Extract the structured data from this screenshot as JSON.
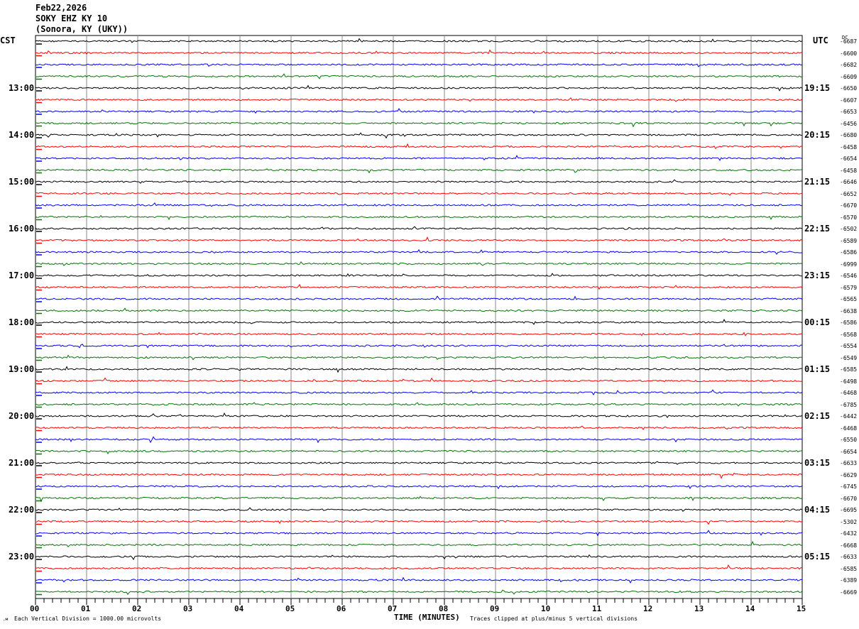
{
  "header": {
    "date": "Feb22,2026",
    "station": "SOKY EHZ KY 10",
    "location": "(Sonora, KY (UKY))"
  },
  "left_axis_label": "CST",
  "right_axis_label": "UTC",
  "dc_label": "DC",
  "chart_data": {
    "type": "line",
    "title": "SOKY EHZ KY 10",
    "xlabel": "TIME (MINUTES)",
    "xlim": [
      0,
      15
    ],
    "x_ticks": [
      "00",
      "01",
      "02",
      "03",
      "04",
      "05",
      "06",
      "07",
      "08",
      "09",
      "10",
      "11",
      "12",
      "13",
      "14",
      "15"
    ],
    "left_hour_labels": [
      "13:00",
      "14:00",
      "15:00",
      "16:00",
      "17:00",
      "18:00",
      "19:00",
      "20:00",
      "21:00",
      "22:00",
      "23:00"
    ],
    "right_hour_labels": [
      "19:15",
      "20:15",
      "21:15",
      "22:15",
      "23:15",
      "00:15",
      "01:15",
      "02:15",
      "03:15",
      "04:15",
      "05:15"
    ],
    "trace_colors": [
      "#000000",
      "#ff0000",
      "#0000ff",
      "#007700"
    ],
    "dc_offsets": [
      "-6687",
      "-6600",
      "-6682",
      "-6609",
      "-6650",
      "-6607",
      "-6653",
      "-6456",
      "-6680",
      "-6458",
      "-6654",
      "-6458",
      "-6646",
      "-6652",
      "-6670",
      "-6570",
      "-6502",
      "-6589",
      "-6586",
      "-6999",
      "-6546",
      "-6579",
      "-6565",
      "-6638",
      "-6586",
      "-6568",
      "-6554",
      "-6549",
      "-6585",
      "-6498",
      "-6468",
      "-6785",
      "-6442",
      "-6468",
      "-6550",
      "-6654",
      "-6633",
      "-6629",
      "-6745",
      "-6670",
      "-6695",
      "-5302",
      "-6432",
      "-6668",
      "-6633",
      "-6585",
      "-6389",
      "-6669"
    ],
    "grid": true
  },
  "footer": {
    "scale_note": "Each Vertical Division = 1000.00 microvolts",
    "clip_note": "Traces clipped at plus/minus 5 vertical divisions"
  }
}
